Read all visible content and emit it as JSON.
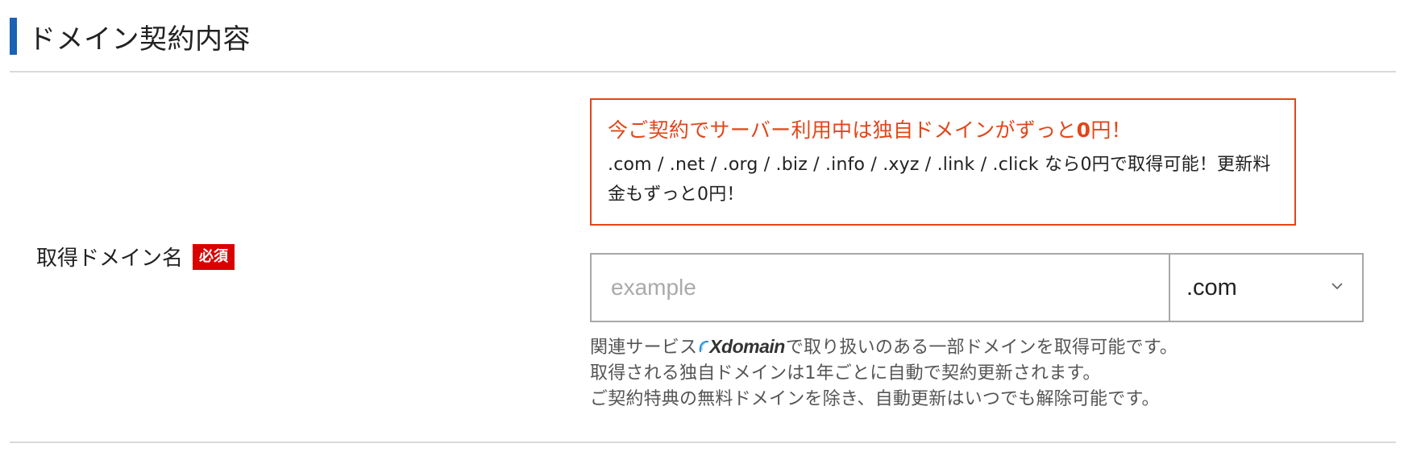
{
  "section": {
    "title": "ドメイン契約内容"
  },
  "field": {
    "label": "取得ドメイン名",
    "required_badge": "必須"
  },
  "promo": {
    "headline_prefix": "今ご契約でサーバー利用中は独自ドメインがずっと",
    "headline_zero": "0",
    "headline_suffix": "円！",
    "body": ".com / .net / .org / .biz / .info / .xyz / .link / .click なら0円で取得可能！更新料金もずっと0円！"
  },
  "domain_input": {
    "placeholder": "example",
    "value": ""
  },
  "tld_select": {
    "selected": ".com"
  },
  "notes": {
    "line1_prefix": "関連サービス",
    "line1_logo": "Xdomain",
    "line1_suffix": "で取り扱いのある一部ドメインを取得可能です。",
    "line2": "取得される独自ドメインは1年ごとに自動で契約更新されます。",
    "line3": "ご契約特典の無料ドメインを除き、自動更新はいつでも解除可能です。"
  },
  "colors": {
    "header_accent": "#1a62b4",
    "promo_orange": "#e2461a",
    "required_red": "#d90000"
  }
}
